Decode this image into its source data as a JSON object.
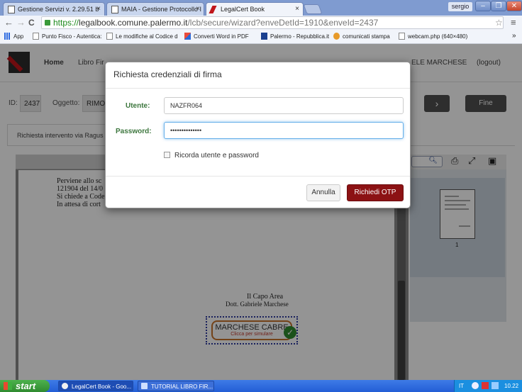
{
  "browser": {
    "tabs": [
      {
        "label": "Gestione Servizi v. 2.29.51 b",
        "close": "×"
      },
      {
        "label": "MAIA - Gestione Protocollo I",
        "close": "×"
      },
      {
        "label": "LegalCert Book",
        "close": "×"
      }
    ],
    "user": "sergio",
    "window_buttons": [
      "–",
      "❐",
      "✕"
    ],
    "nav": {
      "back": "←",
      "forward": "→",
      "reload": "C"
    },
    "url": {
      "scheme": "https://",
      "host": "legalbook.comune.palermo.it",
      "path": "/lcb/secure/wizard?enveDetId=1910&enveId=2437"
    },
    "bookmarks": [
      "App",
      "Punto Fisco - Autentica:",
      "Le modifiche al Codice d",
      "Converti Word in PDF",
      "Palermo - Repubblica.it",
      "comunicati stampa",
      "webcam.php (640×480)"
    ],
    "bookmarks_more": "»"
  },
  "app": {
    "nav": {
      "home": "Home",
      "libro": "Libro Fir",
      "user_name": "ELE MARCHESE",
      "logout": "(logout)"
    },
    "id_label": "ID:",
    "id_value": "2437",
    "oggetto_label": "Oggetto:",
    "oggetto_value": "RIMOZ",
    "fine_label": "Fine",
    "next_icon": "›",
    "tab_label": "Richiesta intervento via Ragus",
    "document": {
      "lines": [
        "Perviene allo sc",
        "121904 del 14/0",
        "Si chiede a Code",
        "In attesa di cort"
      ],
      "signature_title": "Il Capo Area",
      "signature_name": "Dott. Gabriele Marchese",
      "sign_field_name": "MARCHESE CABRE",
      "sign_field_hint": "Clicca per simulare",
      "check": "✓"
    },
    "thumbnail": {
      "page_number": "1"
    }
  },
  "modal": {
    "title": "Richiesta credenziali di firma",
    "user_label": "Utente:",
    "user_value": "NAZFR064",
    "password_label": "Password:",
    "password_value": "••••••••••••••",
    "remember_label": "Ricorda utente e password",
    "cancel_label": "Annulla",
    "submit_label": "Richiedi OTP"
  },
  "taskbar": {
    "start": "start",
    "tasks": [
      "LegalCert Book - Goo...",
      "TUTORIAL LIBRO FIR..."
    ],
    "lang": "IT",
    "time": "10.22"
  }
}
